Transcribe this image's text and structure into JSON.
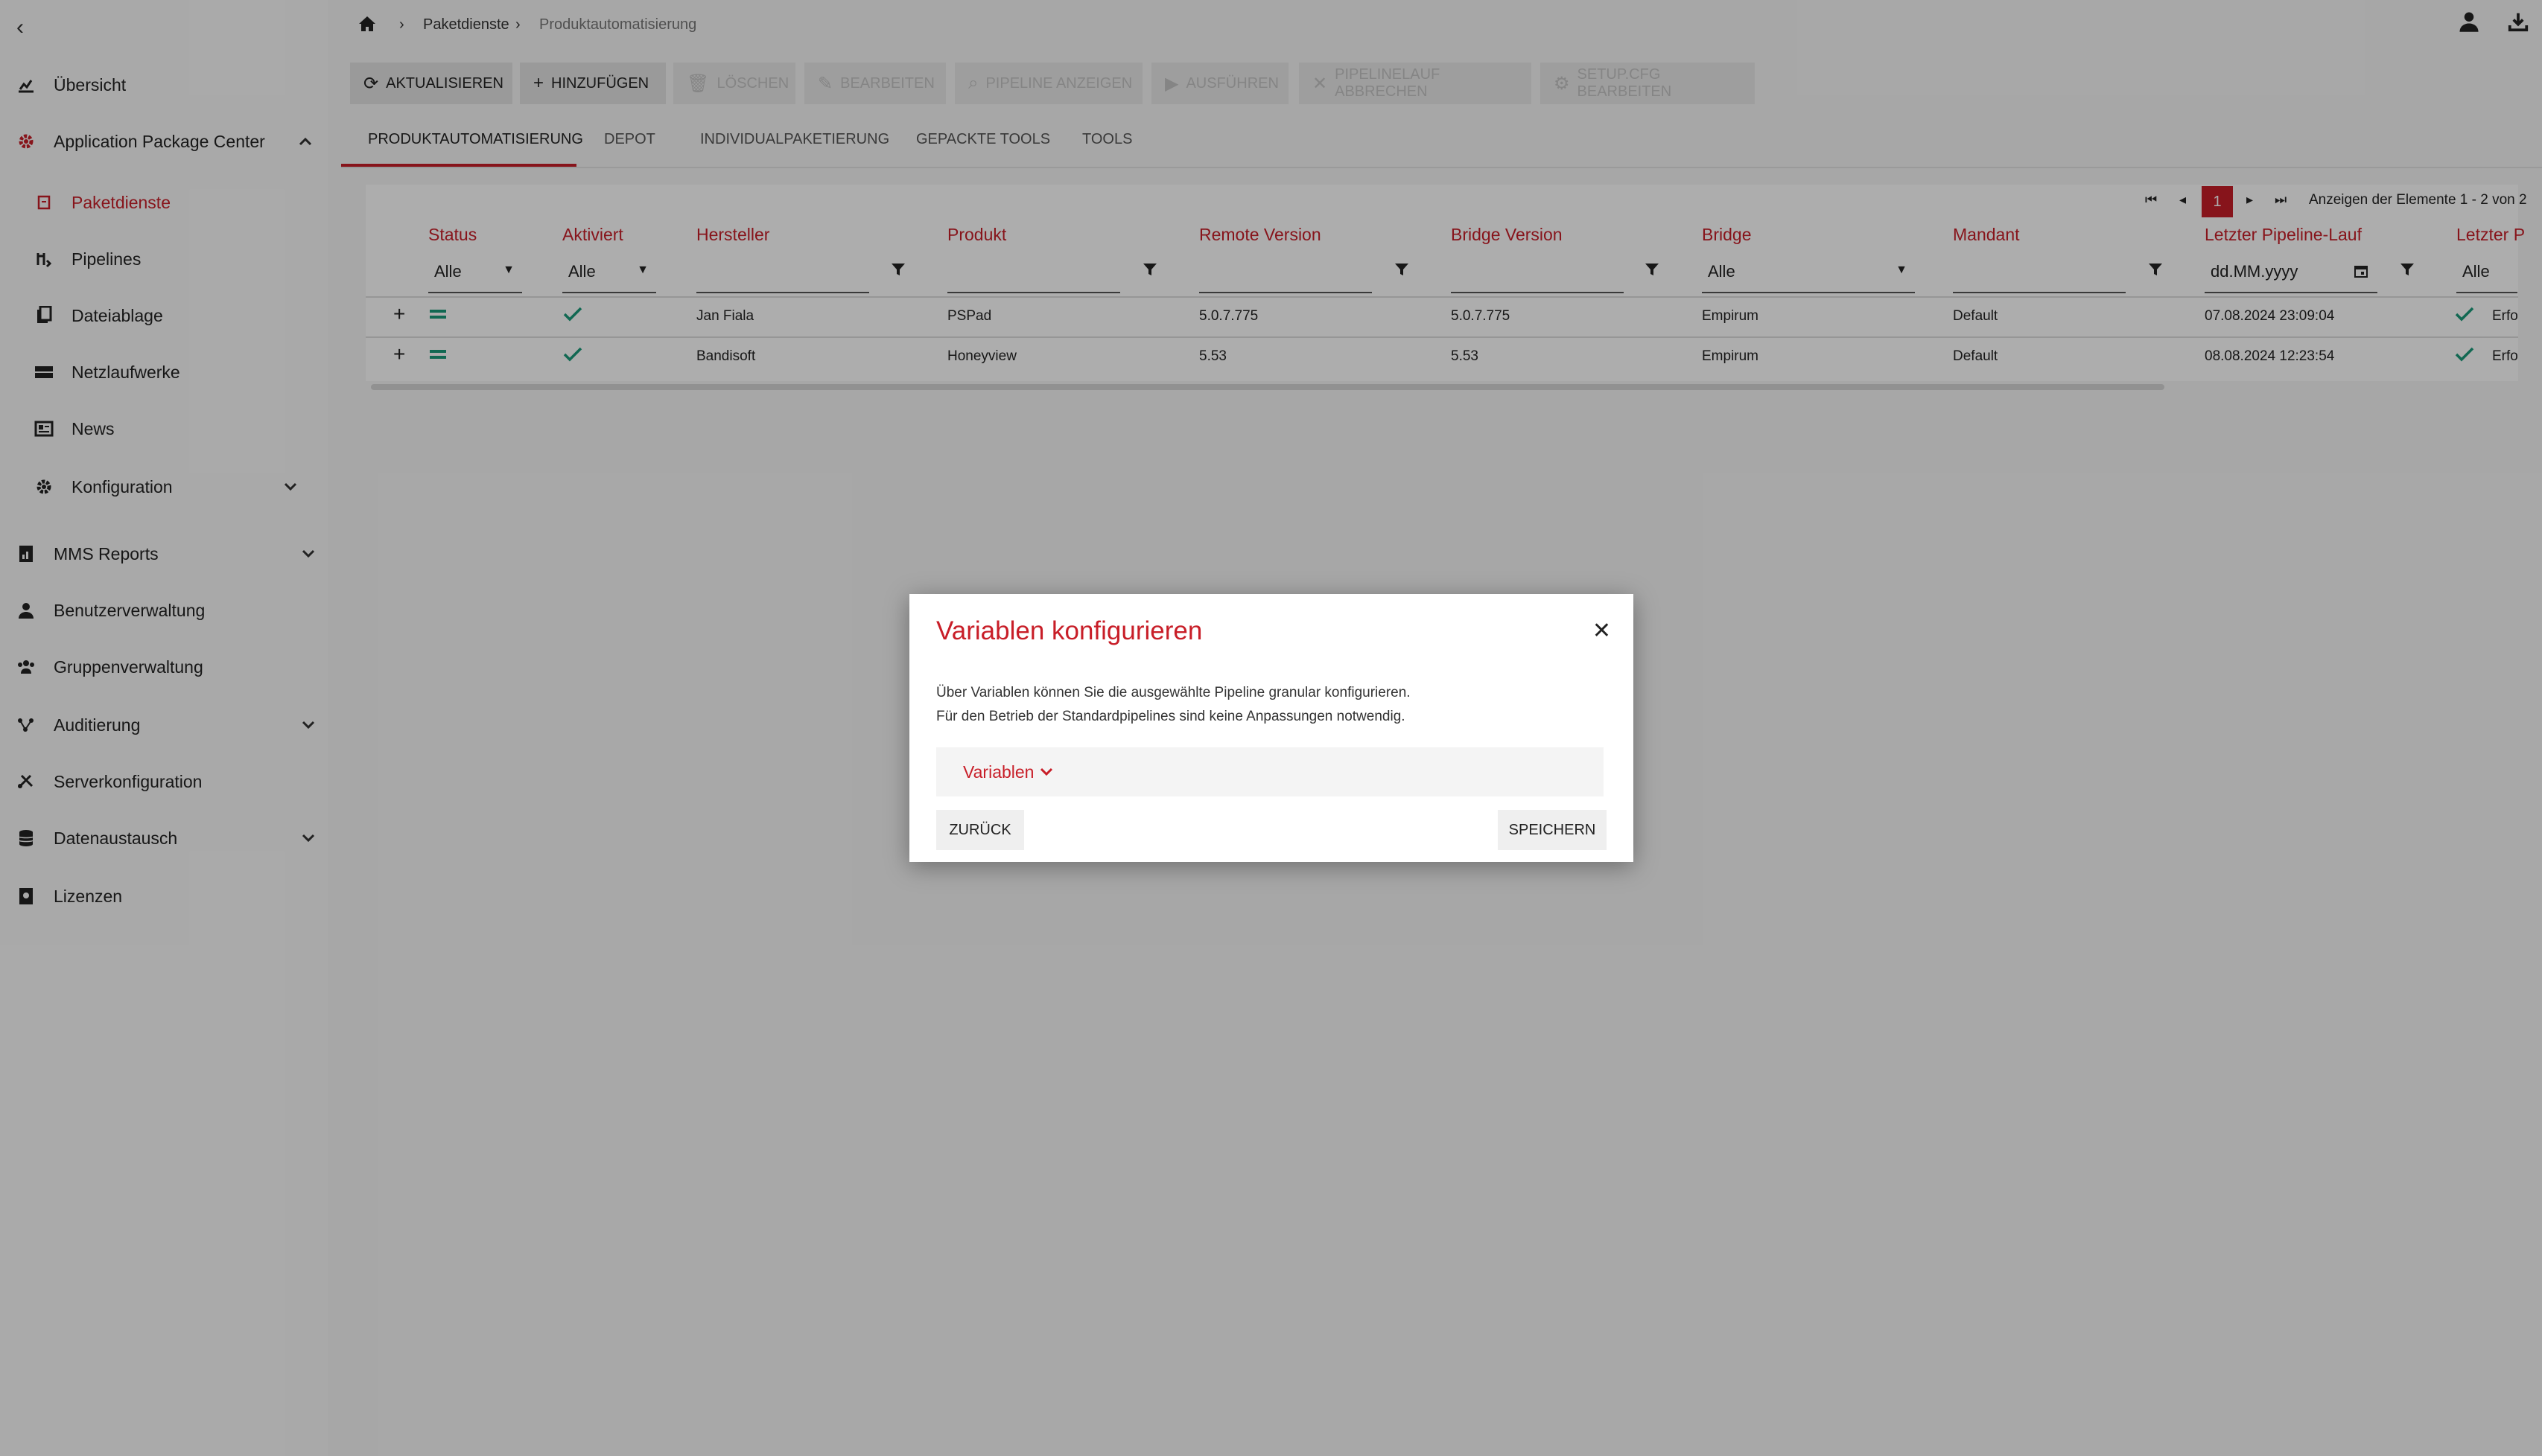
{
  "sidebar": {
    "items": [
      {
        "label": "Übersicht",
        "icon": "chart-line-icon"
      },
      {
        "label": "Application Package Center",
        "icon": "gear-icon"
      },
      {
        "label": "Paketdienste",
        "icon": "package-icon"
      },
      {
        "label": "Pipelines",
        "icon": "pipeline-icon"
      },
      {
        "label": "Dateiablage",
        "icon": "files-icon"
      },
      {
        "label": "Netzlaufwerke",
        "icon": "drive-icon"
      },
      {
        "label": "News",
        "icon": "news-icon"
      },
      {
        "label": "Konfiguration",
        "icon": "cog-icon"
      },
      {
        "label": "MMS Reports",
        "icon": "report-icon"
      },
      {
        "label": "Benutzerverwaltung",
        "icon": "user-icon"
      },
      {
        "label": "Gruppenverwaltung",
        "icon": "group-icon"
      },
      {
        "label": "Auditierung",
        "icon": "audit-icon"
      },
      {
        "label": "Serverkonfiguration",
        "icon": "server-config-icon"
      },
      {
        "label": "Datenaustausch",
        "icon": "database-icon"
      },
      {
        "label": "Lizenzen",
        "icon": "license-icon"
      }
    ]
  },
  "breadcrumb": {
    "items": [
      "Paketdienste",
      "Produktautomatisierung"
    ]
  },
  "toolbar": {
    "refresh": "AKTUALISIEREN",
    "add": "HINZUFÜGEN",
    "delete": "LÖSCHEN",
    "edit": "BEARBEITEN",
    "show_pipeline": "PIPELINE ANZEIGEN",
    "run": "AUSFÜHREN",
    "cancel_run": "PIPELINELAUF ABBRECHEN",
    "edit_setup": "SETUP.CFG BEARBEITEN"
  },
  "tabs": [
    "PRODUKTAUTOMATISIERUNG",
    "DEPOT",
    "INDIVIDUALPAKETIERUNG",
    "GEPACKTE TOOLS",
    "TOOLS"
  ],
  "pager": {
    "page": "1",
    "info": "Anzeigen der Elemente 1 - 2 von 2"
  },
  "grid": {
    "headers": [
      "Status",
      "Aktiviert",
      "Hersteller",
      "Produkt",
      "Remote Version",
      "Bridge Version",
      "Bridge",
      "Mandant",
      "Letzter Pipeline-Lauf",
      "Letzter P"
    ],
    "filters": {
      "status": "Alle",
      "aktiviert": "Alle",
      "bridge": "Alle",
      "date_placeholder": "dd.MM.yyyy",
      "last": "Alle"
    },
    "rows": [
      {
        "hersteller": "Jan Fiala",
        "produkt": "PSPad",
        "remote": "5.0.7.775",
        "bridgever": "5.0.7.775",
        "bridge": "Empirum",
        "mandant": "Default",
        "lauf": "07.08.2024 23:09:04",
        "result": "Erfo"
      },
      {
        "hersteller": "Bandisoft",
        "produkt": "Honeyview",
        "remote": "5.53",
        "bridgever": "5.53",
        "bridge": "Empirum",
        "mandant": "Default",
        "lauf": "08.08.2024 12:23:54",
        "result": "Erfo"
      }
    ]
  },
  "dialog": {
    "title": "Variablen konfigurieren",
    "line1": "Über Variablen können Sie die ausgewählte Pipeline granular konfigurieren.",
    "line2": "Für den Betrieb der Standardpipelines sind keine Anpassungen notwendig.",
    "panel_label": "Variablen",
    "back": "ZURÜCK",
    "save": "SPEICHERN"
  },
  "colors": {
    "accent": "#c81e28",
    "success": "#1a9a7a"
  }
}
